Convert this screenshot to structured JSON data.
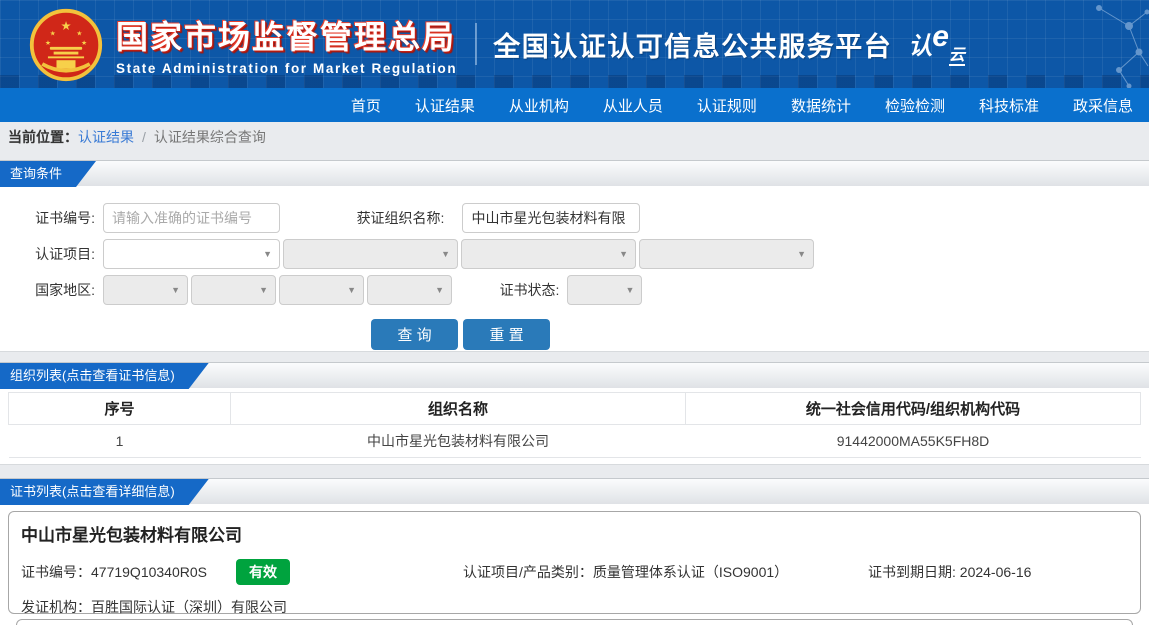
{
  "colors": {
    "header_blue": "#0d57a7",
    "nav_blue": "#0a70cd",
    "tab_blue": "#1569c7",
    "button_blue": "#2a7ab9",
    "badge_green": "#00a33e",
    "link_blue": "#3a7bd5",
    "title_red": "#c61f12"
  },
  "icons": {
    "caret": "▼"
  },
  "header": {
    "org_cn": "国家市场监督管理总局",
    "org_en": "State Administration  for  Market Regulation",
    "platform": "全国认证认可信息公共服务平台",
    "logo_p1": "认",
    "logo_p2": "e",
    "logo_p3": "云"
  },
  "nav": {
    "items": [
      {
        "label": "首页"
      },
      {
        "label": "认证结果"
      },
      {
        "label": "从业机构"
      },
      {
        "label": "从业人员"
      },
      {
        "label": "认证规则"
      },
      {
        "label": "数据统计"
      },
      {
        "label": "检验检测"
      },
      {
        "label": "科技标准"
      },
      {
        "label": "政采信息"
      }
    ]
  },
  "breadcrumb": {
    "label": "当前位置：",
    "link": "认证结果",
    "sep": "/",
    "current": "认证结果综合查询"
  },
  "query": {
    "title": "查询条件",
    "cert_no_label": "证书编号:",
    "cert_no_placeholder": "请输入准确的证书编号",
    "org_label": "获证组织名称:",
    "org_value": "中山市星光包装材料有限",
    "project_label": "认证项目:",
    "country_label": "国家地区:",
    "status_label": "证书状态:",
    "btn_query": "查 询",
    "btn_reset": "重 置"
  },
  "org_list": {
    "title": "组织列表(点击查看证书信息)",
    "headers": [
      "序号",
      "组织名称",
      "统一社会信用代码/组织机构代码"
    ],
    "rows": [
      [
        "1",
        "中山市星光包装材料有限公司",
        "91442000MA55K5FH8D"
      ]
    ]
  },
  "certs": {
    "title": "证书列表(点击查看详细信息)",
    "card": {
      "org_name": "中山市星光包装材料有限公司",
      "cert_no_label": "证书编号：",
      "cert_no": "47719Q10340R0S",
      "status": "有效",
      "project_label": "认证项目/产品类别：",
      "project": "质量管理体系认证（ISO9001）",
      "expiry_label": "证书到期日期: ",
      "expiry": "2024-06-16",
      "issuer_label": "发证机构：",
      "issuer": "百胜国际认证（深圳）有限公司"
    }
  }
}
